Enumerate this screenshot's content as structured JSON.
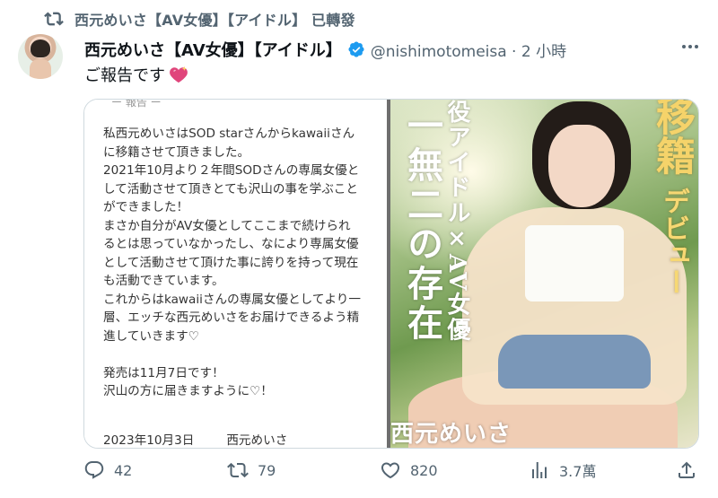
{
  "retweet_bar": {
    "text": "西元めいさ【AV女優】【アイドル】 已轉發"
  },
  "author": {
    "name": "西元めいさ【AV女優】【アイドル】",
    "handle": "@nishimotomeisa · 2 小時",
    "verified": true
  },
  "tweet": {
    "text": "ご報告です"
  },
  "letter": {
    "top_mark": "ー 報告 ー",
    "lines": [
      "私西元めいさはSOD starさんからkawaiiさん",
      "に移籍させて頂きました。",
      "2021年10月より２年間SODさんの専属女優と",
      "して活動させて頂きとても沢山の事を学ぶこと",
      "ができました！",
      "まさか自分がAV女優としてここまで続けられ",
      "るとは思っていなかったし、なにより専属女優",
      "として活動させて頂けた事に誇りを持って現在",
      "も活動できています。",
      "これからはkawaiiさんの専属女優としてより一",
      "層、エッチな西元めいさをお届けできるよう精",
      "進していきます♡",
      "",
      "発売は11月7日です！",
      "沢山の方に届きますように♡！"
    ],
    "date": "2023年10月3日",
    "signature": "西元めいさ"
  },
  "poster": {
    "title_line1": "役アイドル×AV女優",
    "title_line2": "一無二の存在",
    "debut_big": "移籍",
    "debut_small": "デビュー",
    "actress": "西元めいさ"
  },
  "actions": {
    "reply_count": "42",
    "retweet_count": "79",
    "like_count": "820",
    "views_count": "3.7萬"
  },
  "colors": {
    "secondary_text": "#536471",
    "verified_blue": "#1d9bf0",
    "border": "#cfd9de"
  }
}
